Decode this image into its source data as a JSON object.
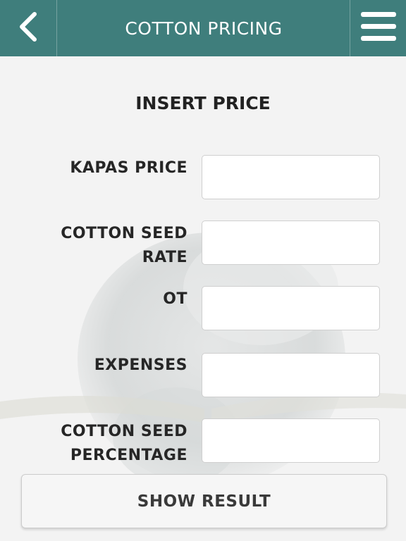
{
  "header": {
    "title": "COTTON PRICING",
    "back_icon": "chevron-left-icon",
    "menu_icon": "hamburger-menu-icon",
    "color": "#3f7e7c"
  },
  "form": {
    "section_title": "INSERT PRICE",
    "fields": [
      {
        "label_lines": [
          "KAPAS PRICE"
        ],
        "value": "",
        "placeholder": ""
      },
      {
        "label_lines": [
          "COTTON SEED",
          "RATE"
        ],
        "value": "",
        "placeholder": ""
      },
      {
        "label_lines": [
          "OT"
        ],
        "value": "",
        "placeholder": ""
      },
      {
        "label_lines": [
          "EXPENSES"
        ],
        "value": "",
        "placeholder": ""
      },
      {
        "label_lines": [
          "COTTON SEED",
          "PERCENTAGE"
        ],
        "value": "",
        "placeholder": ""
      }
    ],
    "submit_label": "SHOW RESULT"
  }
}
